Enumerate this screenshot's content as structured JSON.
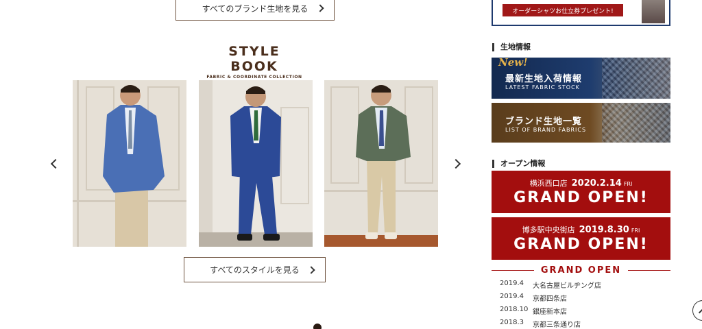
{
  "top_button": {
    "label": "すべてのブランド生地を見る"
  },
  "style_book": {
    "title": "STYLE BOOK",
    "subtitle": "FABRIC & COORDINATE COLLECTION"
  },
  "looks": [
    {
      "jacket": "#4a6fb5",
      "pants": "#d8c7a7",
      "shirt": "#e9eef6",
      "tie": "#7d8fa6"
    },
    {
      "jacket": "#2c4a97",
      "pants": "#2c4a97",
      "shirt": "#f3f3f3",
      "tie": "#2f6b3c"
    },
    {
      "jacket": "#5c6e58",
      "pants": "#d9c9a6",
      "shirt": "#e3ebf4",
      "tie": "#3a4f8f"
    }
  ],
  "style_button": {
    "label": "すべてのスタイルを見る"
  },
  "sidebar": {
    "promo": {
      "ribbon": "オーダーシャツお仕立券プレゼント!"
    },
    "fabric_heading": "生地情報",
    "latest_fabric": {
      "badge": "New!",
      "title": "最新生地入荷情報",
      "subtitle": "LATEST FABRIC STOCK"
    },
    "brand_fabrics": {
      "title": "ブランド生地一覧",
      "subtitle": "LIST OF BRAND FABRICS"
    },
    "open_heading": "オープン情報",
    "openings": [
      {
        "store": "横浜西口店",
        "date": "2020.2.14",
        "dow": "FRI",
        "headline": "GRAND OPEN!"
      },
      {
        "store": "博多駅中央街店",
        "date": "2019.8.30",
        "dow": "FRI",
        "headline": "GRAND OPEN!"
      }
    ],
    "grand_open_title": "GRAND OPEN",
    "grand_open_list": [
      {
        "date": "2019.4",
        "store": "大名古屋ビルヂング店"
      },
      {
        "date": "2019.4",
        "store": "京都四条店"
      },
      {
        "date": "2018.10",
        "store": "銀座新本店"
      },
      {
        "date": "2018.3",
        "store": "京都三条通り店"
      }
    ]
  },
  "colors": {
    "brand_brown": "#4a2e1c",
    "accent_red": "#a30e0e",
    "navy": "#1e3a6e"
  }
}
